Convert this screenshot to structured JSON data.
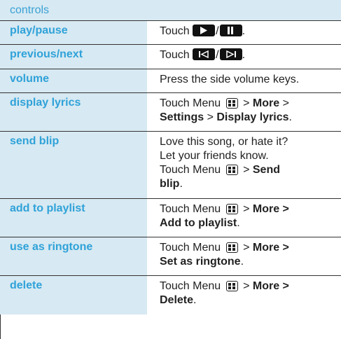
{
  "header": {
    "title": "controls"
  },
  "rows": [
    {
      "label": "play/pause",
      "desc_prefix": "Touch",
      "desc_suffix": "."
    },
    {
      "label": "previous/next",
      "desc_prefix": "Touch",
      "desc_suffix": "."
    },
    {
      "label": "volume",
      "desc": "Press the side volume keys."
    },
    {
      "label": "display lyrics",
      "p1": "Touch Menu",
      "p2": ">",
      "b1": "More",
      "p3": ">",
      "b2": "Settings",
      "p4": ">",
      "b3": "Display lyrics",
      "end": "."
    },
    {
      "label": "send blip",
      "t1": "Love this song, or hate it?",
      "t2": "Let your friends know.",
      "p1": "Touch Menu",
      "p2": ">",
      "b1": "Send",
      "b2": "blip",
      "end": "."
    },
    {
      "label": "add to playlist",
      "p1": "Touch Menu",
      "p2": ">",
      "b1": "More >",
      "b2": "Add to playlist",
      "end": "."
    },
    {
      "label": "use as ringtone",
      "p1": "Touch Menu",
      "p2": ">",
      "b1": "More >",
      "b2": "Set as ringtone",
      "end": "."
    },
    {
      "label": "delete",
      "p1": "Touch Menu",
      "p2": ">",
      "b1": "More >",
      "b2": "Delete",
      "end": "."
    }
  ],
  "icons": {
    "play": "play-icon",
    "pause": "pause-icon",
    "previous": "previous-icon",
    "next": "next-icon",
    "menu": "menu-key-icon"
  }
}
